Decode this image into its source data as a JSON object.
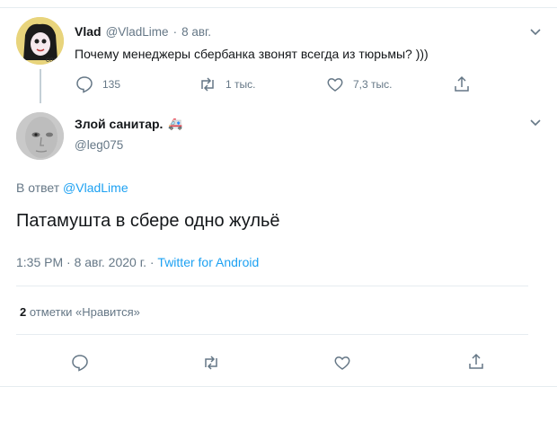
{
  "parent_tweet": {
    "author_name": "Vlad",
    "author_handle": "@VladLime",
    "date": "8 авг.",
    "text": "Почему менеджеры сбербанка звонят всегда из тюрьмы? )))",
    "reply_count": "135",
    "retweet_count": "1 тыс.",
    "like_count": "7,3 тыс."
  },
  "main_tweet": {
    "author_name": "Злой санитар.",
    "author_emoji": "🚑",
    "author_handle": "@leg075",
    "reply_to_prefix": "В ответ",
    "reply_to_handle": "@VladLime",
    "text": "Патамушта в сбере одно жульё",
    "timestamp": "1:35 PM · 8 авг. 2020 г. · ",
    "source": "Twitter for Android",
    "likes_count": "2",
    "likes_label": "отметки «Нравится»"
  },
  "colors": {
    "accent": "#1da1f2",
    "muted_text": "#657786",
    "primary_text": "#14171a",
    "border": "#e6ecf0"
  },
  "icons": [
    "reply-icon",
    "retweet-icon",
    "like-icon",
    "share-icon",
    "chevron-down-icon"
  ]
}
